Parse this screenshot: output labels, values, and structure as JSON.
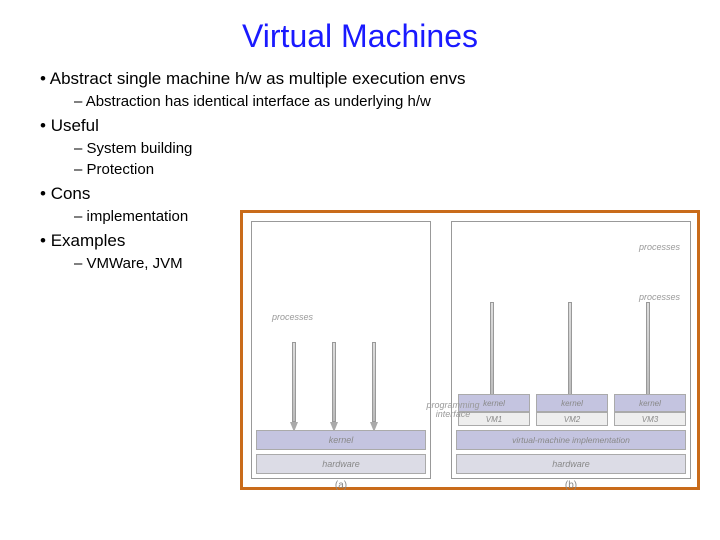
{
  "title": "Virtual Machines",
  "bullets": {
    "b1": "Abstract single machine h/w as multiple execution envs",
    "b1_1": "Abstraction has identical interface as underlying h/w",
    "b2": "Useful",
    "b2_1": "System building",
    "b2_2": "Protection",
    "b3": "Cons",
    "b3_1": "implementation",
    "b4": "Examples",
    "b4_1": "VMWare, JVM"
  },
  "diagram": {
    "processes": "processes",
    "kernel": "kernel",
    "hardware": "hardware",
    "vm_impl": "virtual-machine implementation",
    "vm1": "VM1",
    "vm2": "VM2",
    "vm3": "VM3",
    "prog_if": "programming interface",
    "sub_a": "(a)",
    "sub_b": "(b)"
  }
}
